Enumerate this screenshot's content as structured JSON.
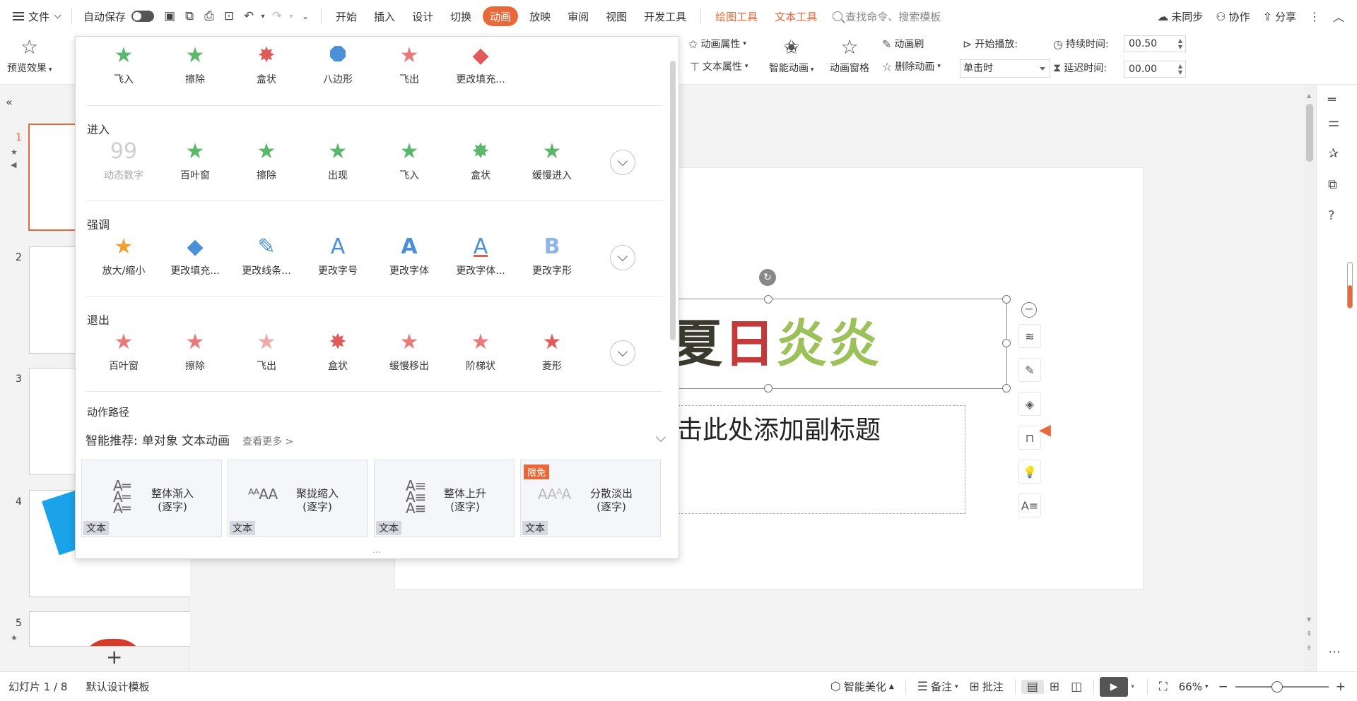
{
  "menubar": {
    "file_label": "文件",
    "autosave_label": "自动保存",
    "tabs": [
      {
        "label": "开始"
      },
      {
        "label": "插入"
      },
      {
        "label": "设计"
      },
      {
        "label": "切换"
      },
      {
        "label": "动画",
        "active": true
      },
      {
        "label": "放映"
      },
      {
        "label": "审阅"
      },
      {
        "label": "视图"
      },
      {
        "label": "开发工具"
      }
    ],
    "contextual_tabs": [
      "绘图工具",
      "文本工具"
    ],
    "search_placeholder": "查找命令、搜索模板",
    "sync_label": "未同步",
    "collab_label": "协作",
    "share_label": "分享"
  },
  "ribbon": {
    "preview_label": "预览效果",
    "anim_props_label": "动画属性",
    "text_props_label": "文本属性",
    "smart_anim_label": "智能动画",
    "anim_pane_label": "动画窗格",
    "anim_brush_label": "动画刷",
    "delete_anim_label": "删除动画",
    "start_play_label": "开始播放:",
    "start_play_value": "单击时",
    "duration_label": "持续时间:",
    "duration_value": "00.50",
    "delay_label": "延迟时间:",
    "delay_value": "00.00"
  },
  "gallery": {
    "recent": [
      {
        "label": "飞入",
        "color": "#5bb86b"
      },
      {
        "label": "擦除",
        "color": "#5bb86b"
      },
      {
        "label": "盒状",
        "color": "#e05a5a"
      },
      {
        "label": "八边形",
        "color": "#4a8fd8"
      },
      {
        "label": "飞出",
        "color": "#e87a7a"
      },
      {
        "label": "更改填充...",
        "color": "#e05a5a"
      }
    ],
    "sections": {
      "enter": {
        "title": "进入",
        "items": [
          "动态数字",
          "百叶窗",
          "擦除",
          "出现",
          "飞入",
          "盒状",
          "缓慢进入"
        ]
      },
      "emphasis": {
        "title": "强调",
        "items": [
          "放大/缩小",
          "更改填充...",
          "更改线条...",
          "更改字号",
          "更改字体",
          "更改字体...",
          "更改字形"
        ]
      },
      "exit": {
        "title": "退出",
        "items": [
          "百叶窗",
          "擦除",
          "飞出",
          "盒状",
          "缓慢移出",
          "阶梯状",
          "菱形"
        ]
      },
      "motion": {
        "title": "动作路径"
      }
    },
    "smart": {
      "label": "智能推荐:",
      "target": "单对象 文本动画",
      "more": "查看更多 >"
    },
    "cards": [
      {
        "title1": "整体渐入",
        "title2": "(逐字)",
        "tag": "文本",
        "badge": ""
      },
      {
        "title1": "聚拢缩入",
        "title2": "(逐字)",
        "tag": "文本",
        "badge": ""
      },
      {
        "title1": "整体上升",
        "title2": "(逐字)",
        "tag": "文本",
        "badge": ""
      },
      {
        "title1": "分散淡出",
        "title2": "(逐字)",
        "tag": "文本",
        "badge": "限免"
      }
    ]
  },
  "thumbnails": {
    "numbers": [
      "1",
      "2",
      "3",
      "4",
      "5"
    ]
  },
  "slide": {
    "title_part1": "夏",
    "title_part2": "日",
    "title_part3": "炎炎",
    "subtitle": "击此处添加副标题"
  },
  "statusbar": {
    "slide_counter": "幻灯片 1 / 8",
    "template": "默认设计模板",
    "beautify_label": "智能美化",
    "notes_label": "备注",
    "comment_label": "批注",
    "zoom_label": "66%",
    "zoom_level": 0.66
  },
  "colors": {
    "accent": "#e8683a",
    "enter_green": "#5bb86b",
    "emphasis_blue": "#4a8fd8",
    "exit_red": "#e05a5a"
  }
}
